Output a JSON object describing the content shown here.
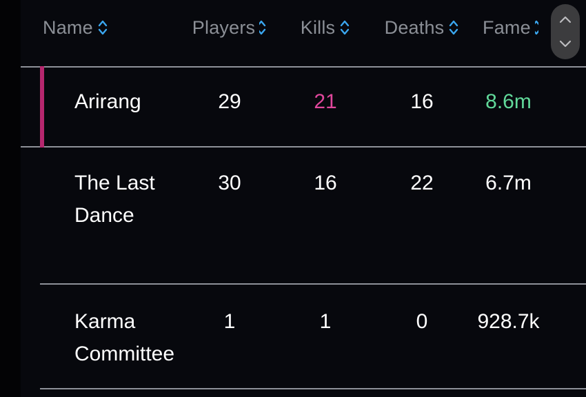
{
  "table": {
    "columns": [
      {
        "id": "name",
        "label": "Name",
        "sort_icon": "sort-chevrons-icon",
        "sortable": true
      },
      {
        "id": "players",
        "label": "Players",
        "sort_icon": "sort-chevrons-icon",
        "sortable": true
      },
      {
        "id": "kills",
        "label": "Kills",
        "sort_icon": "sort-chevrons-icon",
        "sortable": true
      },
      {
        "id": "deaths",
        "label": "Deaths",
        "sort_icon": "sort-chevrons-icon",
        "sortable": true
      },
      {
        "id": "fame",
        "label": "Fame",
        "sort_icon": "sort-chevrons-icon",
        "sortable": true
      }
    ],
    "rows": [
      {
        "name": "Arirang",
        "players": "29",
        "kills": "21",
        "deaths": "16",
        "fame": "8.6m",
        "highlighted": true,
        "kills_color": "#e0479c",
        "fame_color": "#61d99a"
      },
      {
        "name": "The Last Dance",
        "players": "30",
        "kills": "16",
        "deaths": "22",
        "fame": "6.7m",
        "highlighted": false
      },
      {
        "name": "Karma Committee",
        "players": "1",
        "kills": "1",
        "deaths": "0",
        "fame": "928.7k",
        "highlighted": false
      }
    ]
  },
  "scrollbar": {
    "name": "scroll-pill",
    "up_icon": "chevron-up-icon",
    "down_icon": "chevron-down-icon"
  },
  "colors": {
    "background": "#07080d",
    "gutter": "#030305",
    "header_text": "#8b8f96",
    "row_text": "#ffffff",
    "accent_pink": "#b6276e",
    "value_pink": "#e0479c",
    "value_green": "#61d99a",
    "sort_icon_blue": "#3ba7f0",
    "divider": "#8e9199",
    "scroll_pill": "#3c3c3e"
  }
}
